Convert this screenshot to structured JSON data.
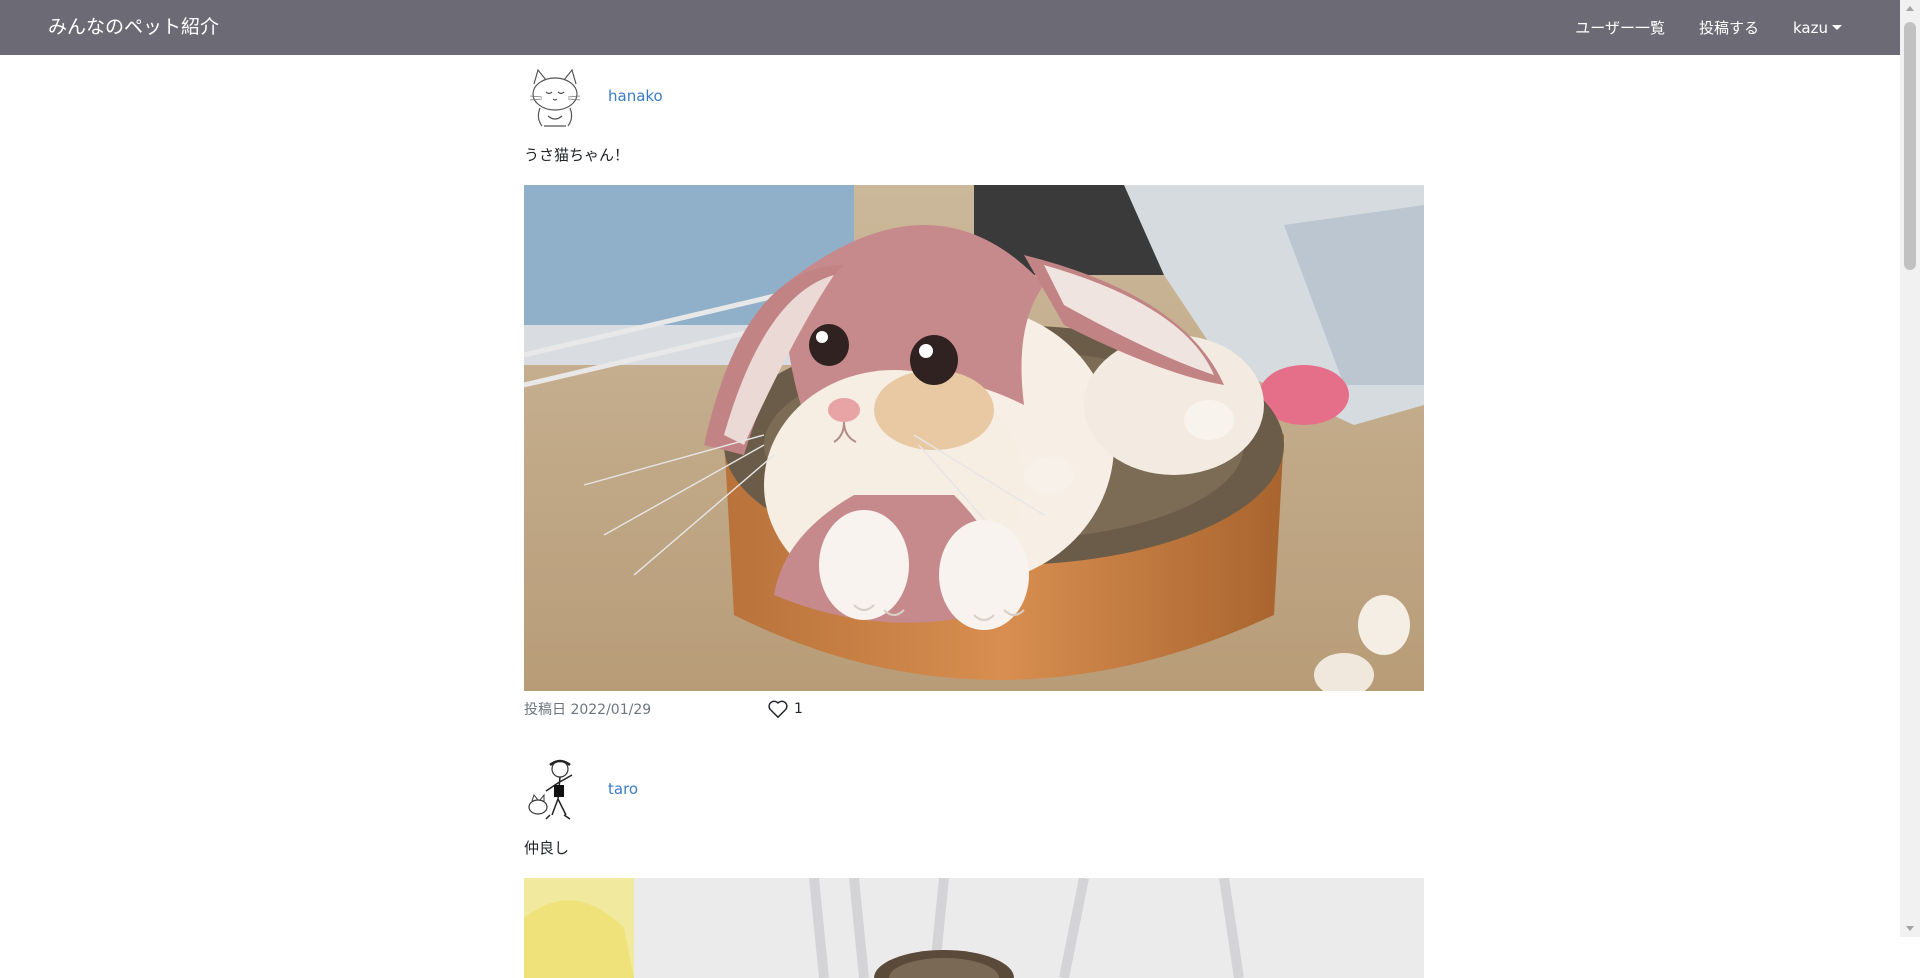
{
  "navbar": {
    "brand": "みんなのペット紹介",
    "links": [
      "ユーザー一覧",
      "投稿する"
    ],
    "user_menu": "kazu"
  },
  "posts": [
    {
      "username": "hanako",
      "caption": "うさ猫ちゃん！",
      "date_label": "投稿日 2022/01/29",
      "likes": "1"
    },
    {
      "username": "taro",
      "caption": "仲良し"
    }
  ],
  "icons": [
    "heart-icon",
    "caret-down-icon"
  ],
  "colors": {
    "navbar_bg": "#6c6b75",
    "link": "#3a7bc8",
    "date_text": "#6c757d"
  }
}
